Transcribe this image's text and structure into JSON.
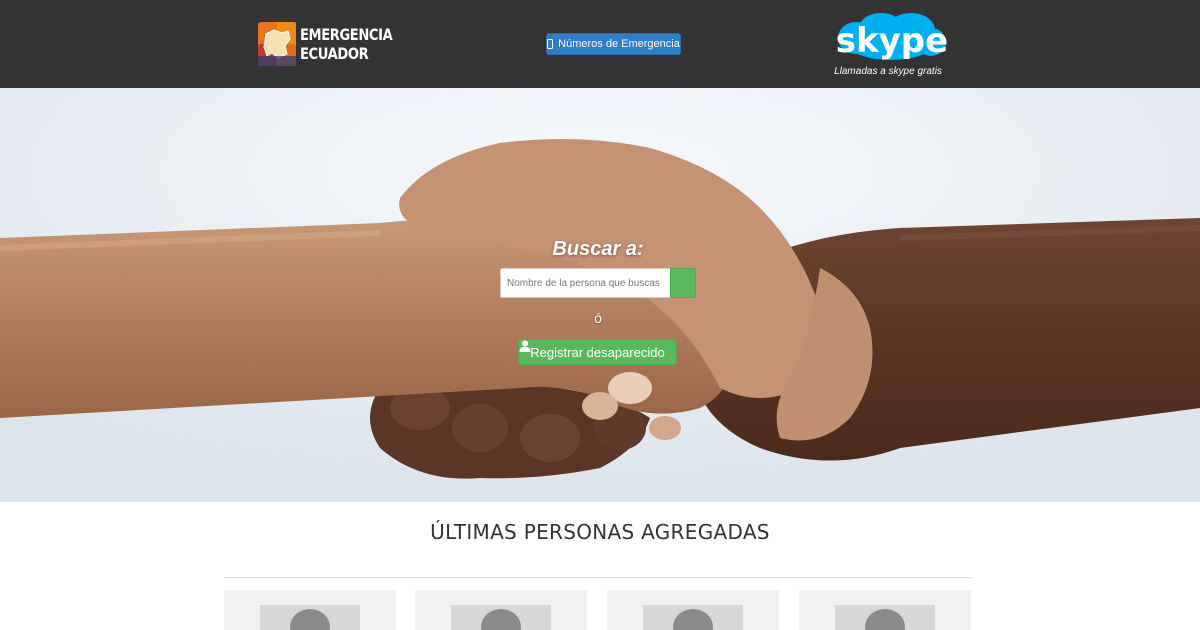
{
  "header": {
    "logo_line1": "EMERGENCIA",
    "logo_line2": "ECUADOR",
    "numbers_button": "Números de Emergencia",
    "skype_word": "skype",
    "skype_tagline": "Llamadas a skype gratis"
  },
  "hero": {
    "search_title": "Buscar a:",
    "search_placeholder": "Nombre de la persona que buscas",
    "or_text": "ó",
    "register_button": "Registrar desaparecido"
  },
  "latest": {
    "title": "ÚLTIMAS PERSONAS AGREGADAS",
    "cards": [
      {
        "photo": "avatar-placeholder-icon"
      },
      {
        "photo": "avatar-placeholder-icon"
      },
      {
        "photo": "avatar-placeholder-icon"
      },
      {
        "photo": "avatar-placeholder-icon"
      }
    ]
  },
  "colors": {
    "header_bg": "#333333",
    "primary_button": "#2f7cc7",
    "success_button": "#5cb85c",
    "skype_blue": "#00aff0"
  }
}
